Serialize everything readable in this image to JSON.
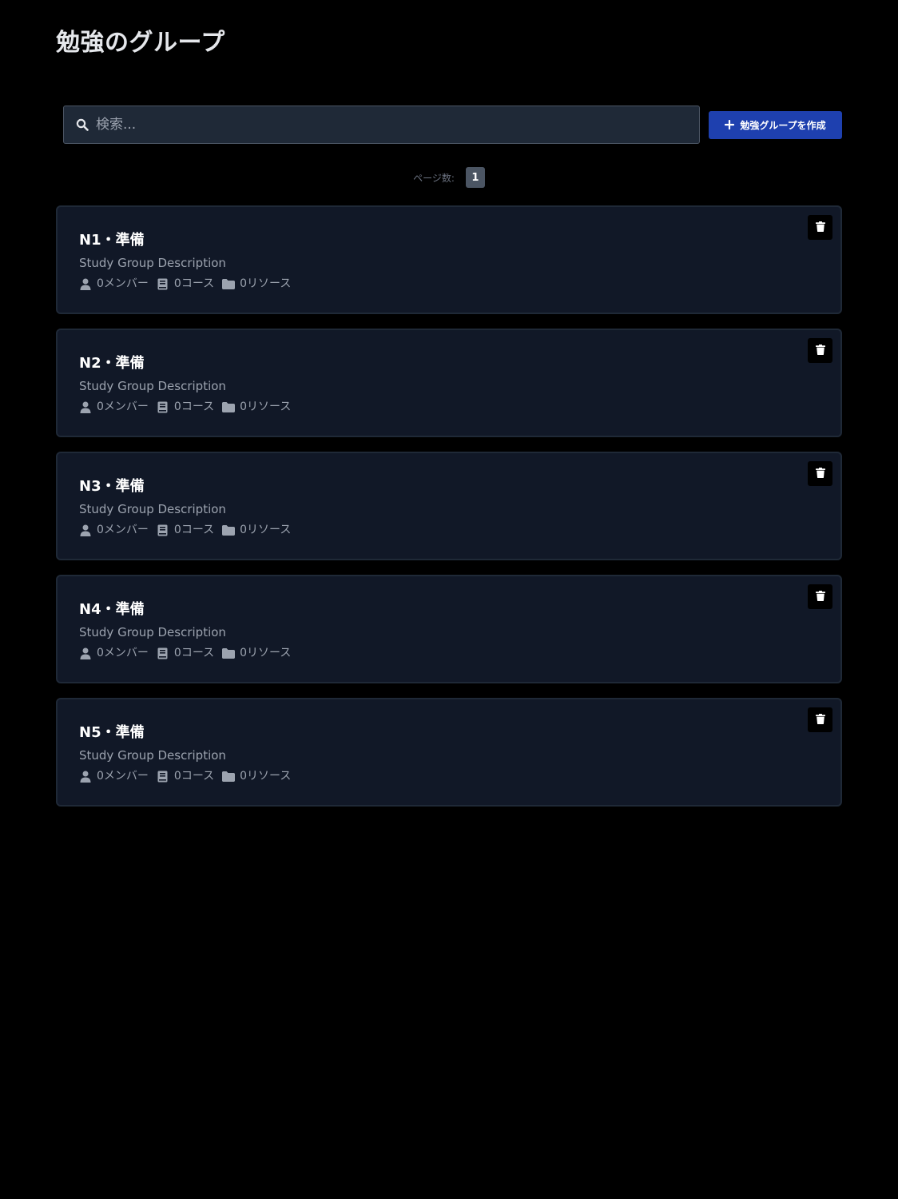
{
  "page": {
    "title": "勉強のグループ"
  },
  "search": {
    "placeholder": "検索..."
  },
  "toolbar": {
    "create_label": "勉強グループを作成"
  },
  "pagination": {
    "label": "ページ数:",
    "pages": [
      "1"
    ],
    "current": "1"
  },
  "groups": [
    {
      "title": "N1・準備",
      "description": "Study Group Description",
      "members": "0メンバー",
      "courses": "0コース",
      "resources": "0リソース"
    },
    {
      "title": "N2・準備",
      "description": "Study Group Description",
      "members": "0メンバー",
      "courses": "0コース",
      "resources": "0リソース"
    },
    {
      "title": "N3・準備",
      "description": "Study Group Description",
      "members": "0メンバー",
      "courses": "0コース",
      "resources": "0リソース"
    },
    {
      "title": "N4・準備",
      "description": "Study Group Description",
      "members": "0メンバー",
      "courses": "0コース",
      "resources": "0リソース"
    },
    {
      "title": "N5・準備",
      "description": "Study Group Description",
      "members": "0メンバー",
      "courses": "0コース",
      "resources": "0リソース"
    }
  ],
  "icons": {
    "search": "search-icon",
    "plus": "plus-icon",
    "member": "user-icon",
    "course": "book-icon",
    "resource": "folder-icon",
    "delete": "trash-icon"
  },
  "colors": {
    "background": "#000000",
    "card": "#111827",
    "card_border": "#1f2937",
    "accent": "#1e40af",
    "muted_text": "#9ca3af"
  }
}
